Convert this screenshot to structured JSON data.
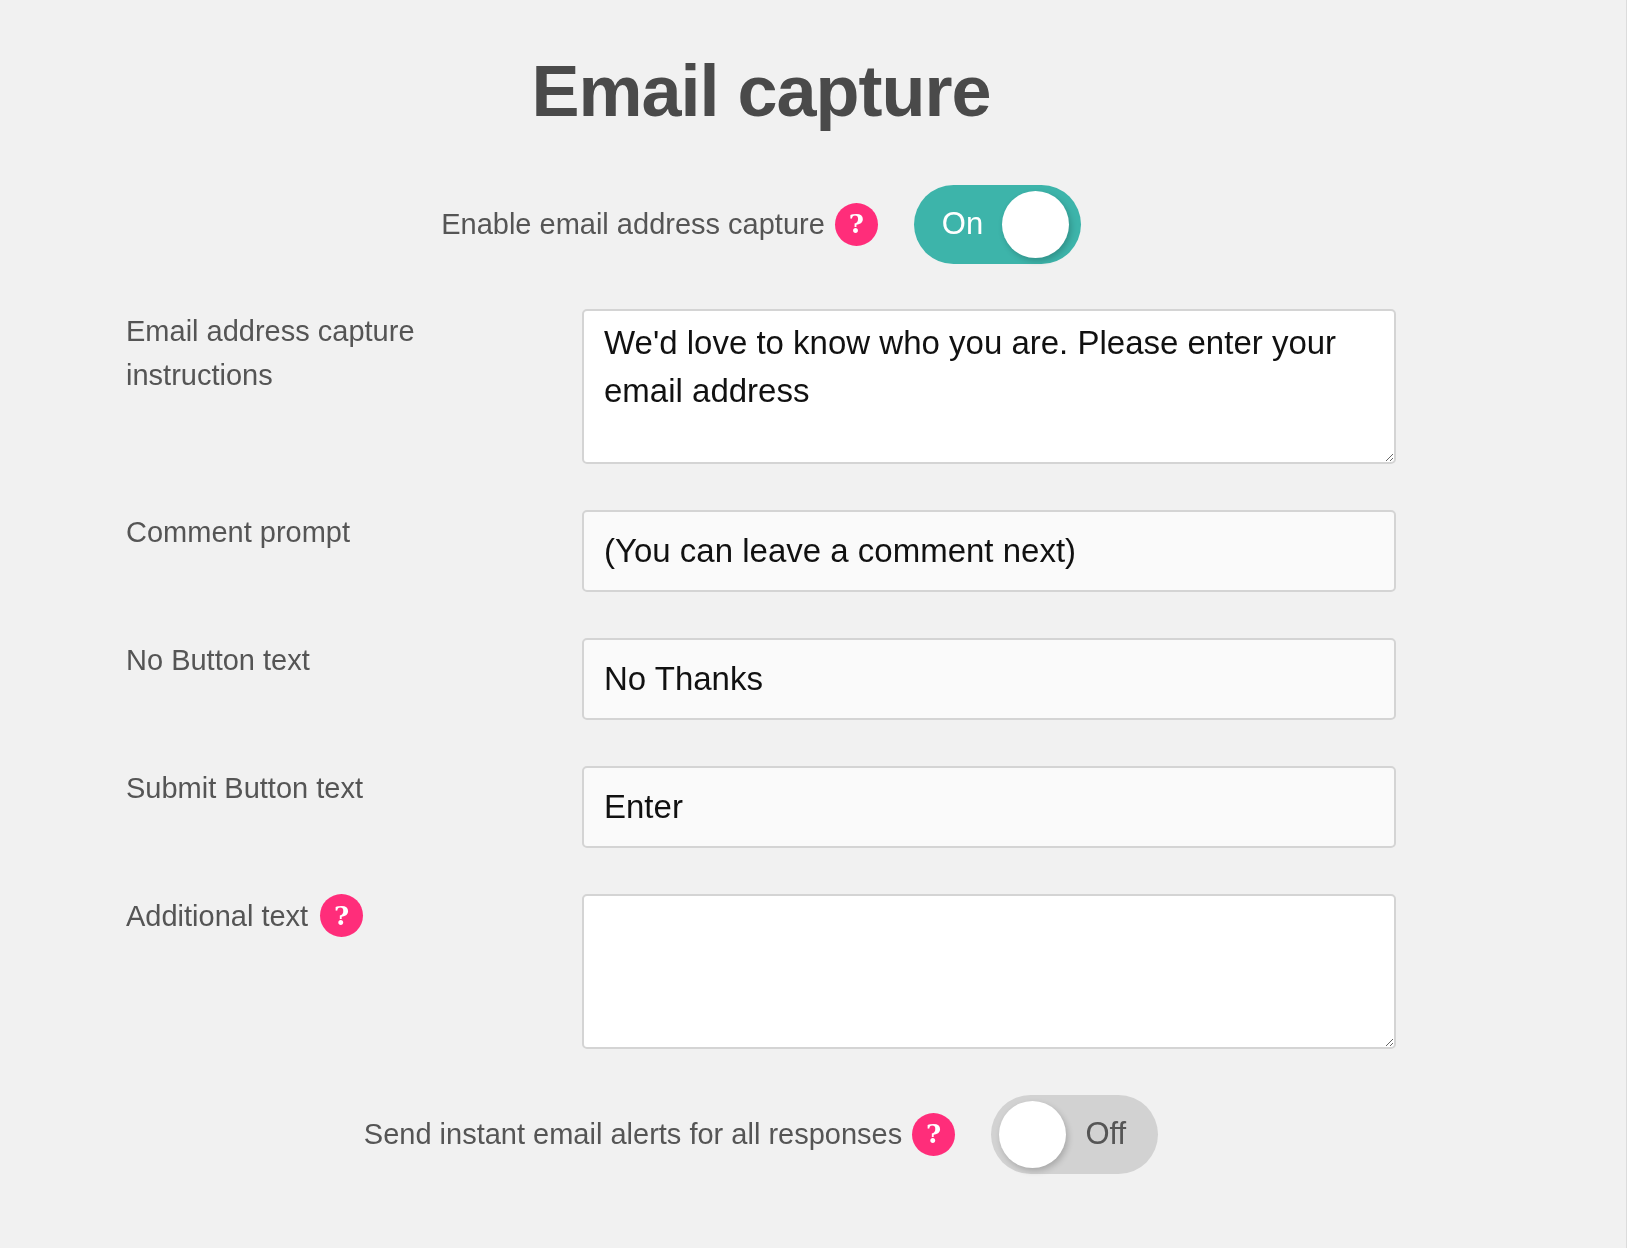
{
  "title": "Email capture",
  "capture_toggle": {
    "label": "Enable email address capture",
    "help": "?",
    "on": true,
    "state_text": "On"
  },
  "fields": [
    {
      "label": "Email address capture instructions",
      "kind": "textarea",
      "value": "We'd love to know who you are. Please enter your email address"
    },
    {
      "label": "Comment prompt",
      "kind": "input",
      "value": "(You can leave a comment next)"
    },
    {
      "label": "No Button text",
      "kind": "input",
      "value": "No Thanks"
    },
    {
      "label": "Submit Button text",
      "kind": "input",
      "value": "Enter"
    },
    {
      "label": "Additional text",
      "kind": "textarea",
      "help": "?"
    }
  ],
  "alerts_toggle": {
    "label": "Send instant email alerts for all responses",
    "help": "?",
    "on": false,
    "state_text": "Off"
  }
}
